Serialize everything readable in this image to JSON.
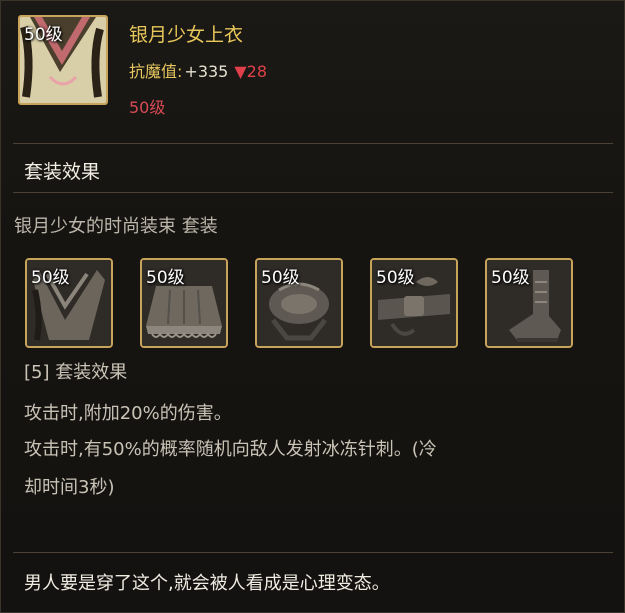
{
  "item": {
    "level_badge": "50级",
    "name": "银月少女上衣",
    "stat_label": "抗魔值:",
    "stat_value": "+335",
    "stat_diff": "▼28",
    "required_level": "50级"
  },
  "set": {
    "heading": "套装效果",
    "name": "银月少女的时尚装束 套装",
    "pieces": [
      {
        "level_badge": "50级",
        "icon": "top-icon"
      },
      {
        "level_badge": "50级",
        "icon": "skirt-icon"
      },
      {
        "level_badge": "50级",
        "icon": "shoulder-icon"
      },
      {
        "level_badge": "50级",
        "icon": "belt-icon"
      },
      {
        "level_badge": "50级",
        "icon": "shoes-icon"
      }
    ],
    "bonus_title": "[5] 套装效果",
    "bonus_line1": "攻击时,附加20%的伤害。",
    "bonus_line2": "攻击时,有50%的概率随机向敌人发射冰冻针刺。(冷",
    "bonus_line3": "却时间3秒)"
  },
  "flavor_text": "男人要是穿了这个,就会被人看成是心理变态。",
  "colors": {
    "item_name": "#e8c85a",
    "stat_label": "#e6c660",
    "stat_decrease": "#e0404a",
    "required_level": "#d84a56",
    "icon_border": "#c8a35a"
  }
}
